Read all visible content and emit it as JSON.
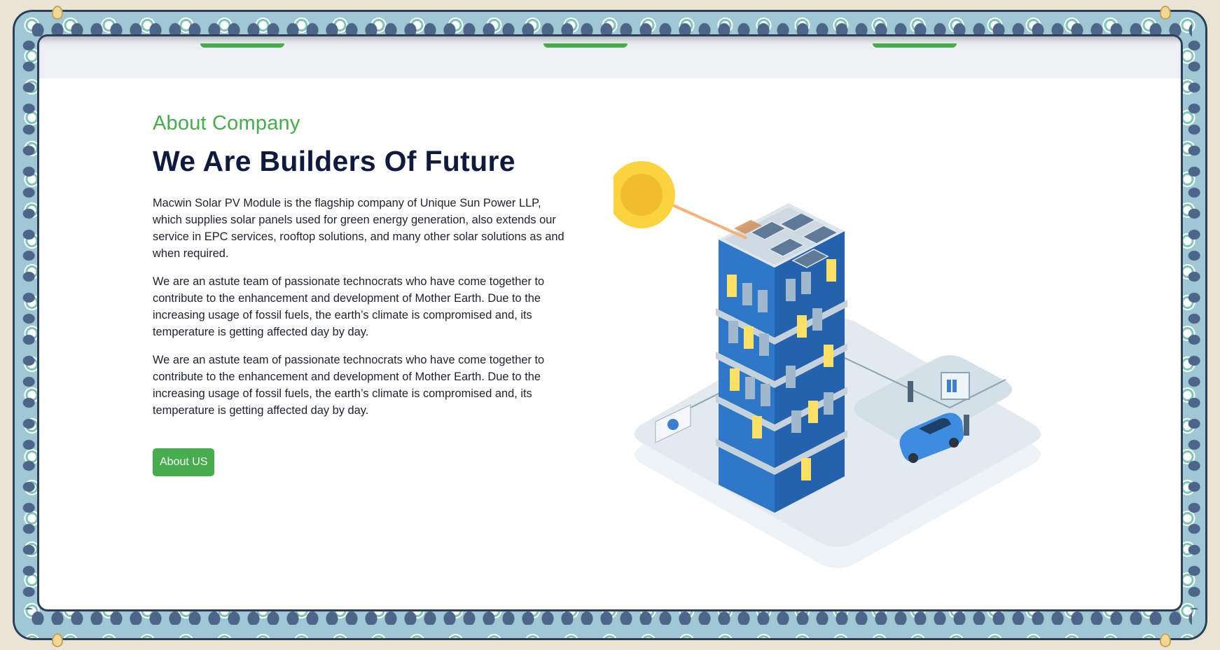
{
  "about": {
    "eyebrow": "About Company",
    "headline": "We Are Builders Of Future",
    "paragraphs": [
      "Macwin Solar PV Module is the flagship company of Unique Sun Power LLP, which supplies solar panels used for green energy generation, also extends our service in EPC services, rooftop solutions, and many other solar solutions as and when required.",
      "We are an astute team of passionate technocrats who have come together to contribute to the enhancement and development of Mother Earth. Due to the increasing usage of fossil fuels, the earth’s climate is compromised and, its temperature is getting affected day by day.",
      "We are an astute team of passionate technocrats who have come together to contribute to the enhancement and development of Mother Earth. Due to the increasing usage of fossil fuels, the earth’s climate is compromised and, its temperature is getting affected day by day."
    ],
    "button_label": "About US"
  },
  "illustration": {
    "icon": "solar-building-ev-charging-illustration"
  },
  "colors": {
    "accent": "#45ad4d",
    "heading": "#0e1b3d",
    "frame": "#9fc8d4"
  }
}
